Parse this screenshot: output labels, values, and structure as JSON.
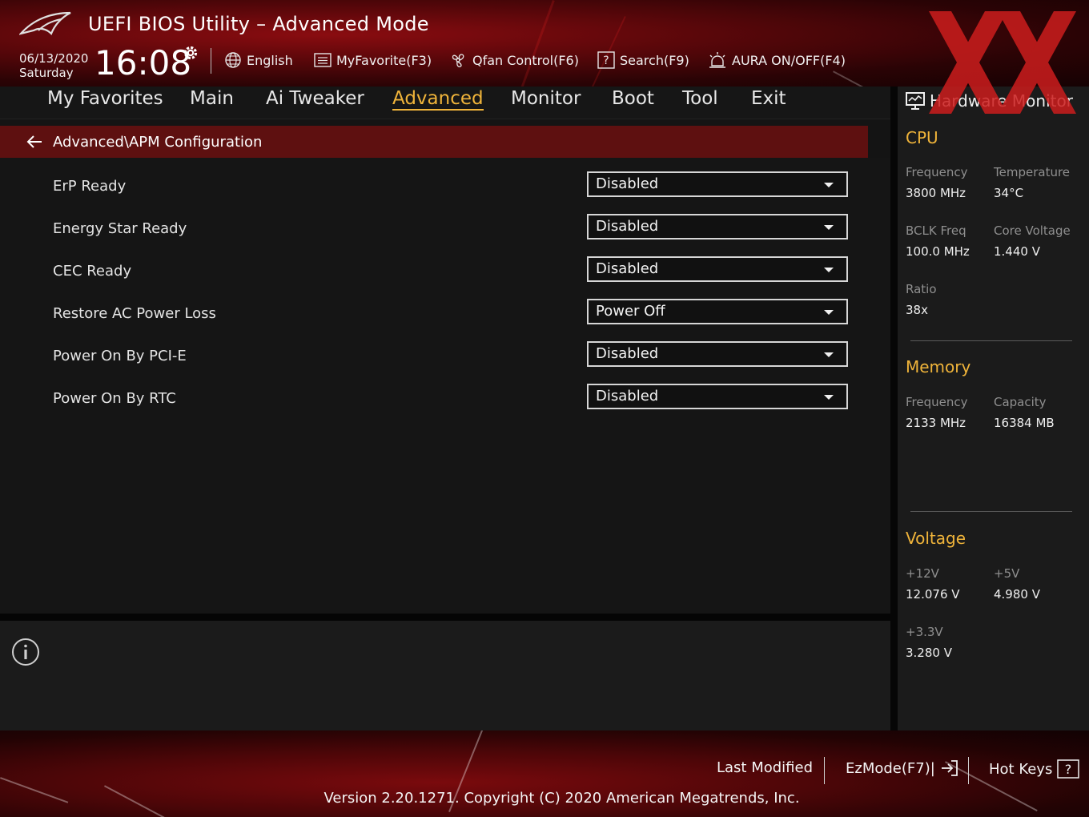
{
  "header": {
    "title": "UEFI BIOS Utility – Advanced Mode",
    "date": "06/13/2020",
    "day": "Saturday",
    "time": "16:08",
    "language": "English",
    "favorite": "MyFavorite(F3)",
    "qfan": "Qfan Control(F6)",
    "search": "Search(F9)",
    "aura": "AURA ON/OFF(F4)",
    "icons": [
      "rog-logo-icon",
      "gear-icon",
      "globe-icon",
      "favorite-list-icon",
      "fan-icon",
      "search-box-icon",
      "aura-light-icon"
    ]
  },
  "menu": {
    "items": [
      "My Favorites",
      "Main",
      "Ai Tweaker",
      "Advanced",
      "Monitor",
      "Boot",
      "Tool",
      "Exit"
    ],
    "active": "Advanced"
  },
  "breadcrumb": "Advanced\\APM Configuration",
  "settings": [
    {
      "label": "ErP Ready",
      "value": "Disabled"
    },
    {
      "label": "Energy Star Ready",
      "value": "Disabled"
    },
    {
      "label": "CEC Ready",
      "value": "Disabled"
    },
    {
      "label": "Restore AC Power Loss",
      "value": "Power Off"
    },
    {
      "label": "Power On By PCI-E",
      "value": "Disabled"
    },
    {
      "label": "Power On By RTC",
      "value": "Disabled"
    }
  ],
  "hardware_monitor": {
    "title": "Hardware Monitor",
    "cpu": {
      "heading": "CPU",
      "frequency_label": "Frequency",
      "frequency": "3800 MHz",
      "temperature_label": "Temperature",
      "temperature": "34°C",
      "bclk_label": "BCLK Freq",
      "bclk": "100.0 MHz",
      "core_voltage_label": "Core Voltage",
      "core_voltage": "1.440 V",
      "ratio_label": "Ratio",
      "ratio": "38x"
    },
    "memory": {
      "heading": "Memory",
      "frequency_label": "Frequency",
      "frequency": "2133 MHz",
      "capacity_label": "Capacity",
      "capacity": "16384 MB"
    },
    "voltage": {
      "heading": "Voltage",
      "v12_label": "+12V",
      "v12": "12.076 V",
      "v5_label": "+5V",
      "v5": "4.980 V",
      "v33_label": "+3.3V",
      "v33": "3.280 V"
    }
  },
  "footer": {
    "last_modified": "Last Modified",
    "ezmode": "EzMode(F7)|",
    "hotkeys": "Hot Keys",
    "version": "Version 2.20.1271.",
    "copyright": "Copyright (C) 2020 American Megatrends, Inc."
  },
  "colors": {
    "accent": "#f0b43a",
    "breadcrumb_bg": "#5e1010",
    "watermark": "#cc1d1d"
  }
}
